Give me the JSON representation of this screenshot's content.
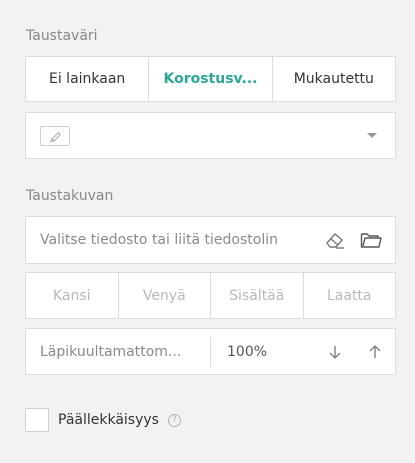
{
  "background_color": {
    "label": "Taustaväri",
    "options": [
      "Ei lainkaan",
      "Korostusv...",
      "Mukautettu"
    ],
    "selected_index": 1,
    "accent": "#2aa892"
  },
  "color_select": {
    "swatch_icon": "brush-icon",
    "caret_icon": "caret-down-icon"
  },
  "background_image": {
    "label": "Taustakuvan",
    "placeholder": "Valitse tiedosto tai liitä tiedostolin",
    "clear_icon": "eraser-icon",
    "browse_icon": "folder-icon",
    "fit_options": [
      "Kansi",
      "Venyä",
      "Sisältää",
      "Laatta"
    ]
  },
  "opacity": {
    "label": "Läpikuultamattom...",
    "value": "100%",
    "decrement_icon": "arrow-down-icon",
    "increment_icon": "arrow-up-icon"
  },
  "overlap": {
    "label": "Päällekkäisyys",
    "checked": false,
    "help": "?"
  }
}
